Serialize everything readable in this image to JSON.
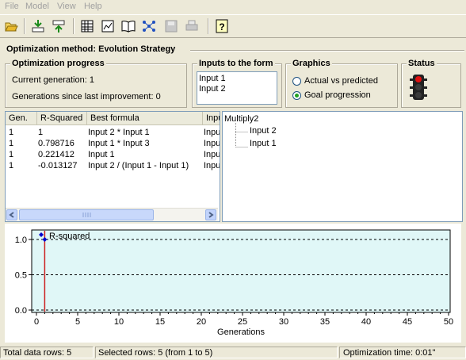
{
  "menu": {
    "items": [
      "File",
      "Model",
      "View",
      "Help"
    ]
  },
  "toolbar": {
    "icons": [
      "open-icon",
      "import-icon",
      "export-icon",
      "table-icon",
      "dataset-icon",
      "book-icon",
      "network-icon",
      "save-icon",
      "print-icon",
      "help-icon"
    ]
  },
  "method_title": "Optimization method: Evolution Strategy",
  "progress": {
    "title": "Optimization progress",
    "current_generation": "Current generation: 1",
    "generations_since": "Generations since last improvement: 0"
  },
  "inputs": {
    "title": "Inputs to the form",
    "items": [
      "Input 1",
      "Input 2"
    ]
  },
  "graphics": {
    "title": "Graphics",
    "options": [
      "Actual vs predicted",
      "Goal progression"
    ],
    "selected": "Goal progression"
  },
  "status": {
    "title": "Status",
    "light": "red"
  },
  "table": {
    "columns": [
      "Gen.",
      "R-Squared",
      "Best formula",
      "Inpu"
    ],
    "rows": [
      [
        "1",
        "1",
        "Input 2 * Input 1",
        "Inpu"
      ],
      [
        "1",
        "0.798716",
        "Input 1 * Input 3",
        "Inpu"
      ],
      [
        "1",
        "0.221412",
        "Input 1",
        "Inpu"
      ],
      [
        "1",
        "-0.013127",
        "Input 2 / (Input 1 - Input 1)",
        "Inpu"
      ]
    ]
  },
  "tree": {
    "root": "Multiply2",
    "children": [
      "Input 2",
      "Input 1"
    ]
  },
  "chart_data": {
    "type": "line",
    "series": [
      {
        "name": "R-squared",
        "x": [
          1
        ],
        "values": [
          1.0
        ]
      }
    ],
    "xlabel": "Generations",
    "ylabel": "",
    "xlim": [
      0,
      50
    ],
    "ylim": [
      0.0,
      1.0
    ],
    "xticks": [
      "0",
      "5",
      "10",
      "15",
      "20",
      "25",
      "30",
      "35",
      "40",
      "45",
      "50"
    ],
    "yticks": [
      "0.0",
      "0.5",
      "1.0"
    ],
    "grid": "dashed horizontal",
    "legend": "top-left",
    "background": "#e0f7f7",
    "current_generation_marker": 1
  },
  "statusbar": {
    "total_rows": "Total data rows: 5",
    "selected_rows": "Selected rows: 5  (from 1 to 5)",
    "optimization_time": "Optimization time: 0:01\""
  }
}
